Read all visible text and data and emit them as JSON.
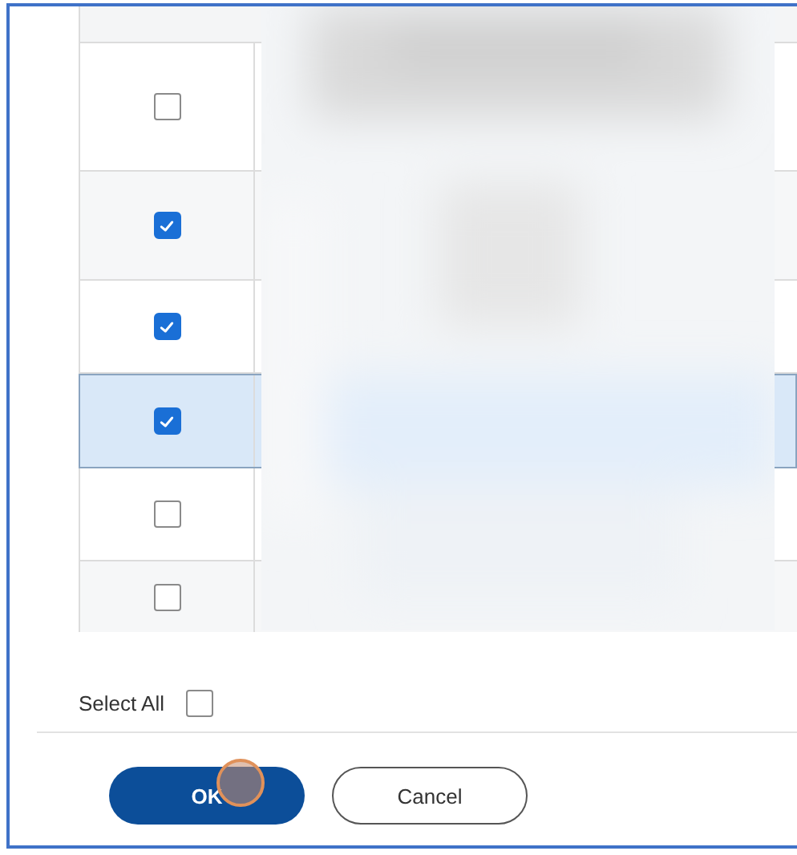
{
  "table": {
    "rows": [
      {
        "checked": false,
        "selected": false
      },
      {
        "checked": true,
        "selected": false
      },
      {
        "checked": true,
        "selected": false
      },
      {
        "checked": true,
        "selected": true
      },
      {
        "checked": false,
        "selected": false
      },
      {
        "checked": false,
        "selected": false
      }
    ]
  },
  "select_all": {
    "label": "Select All",
    "checked": false
  },
  "buttons": [
    {
      "label": "OK",
      "kind": "primary"
    },
    {
      "label": "Cancel",
      "kind": "secondary"
    }
  ]
}
